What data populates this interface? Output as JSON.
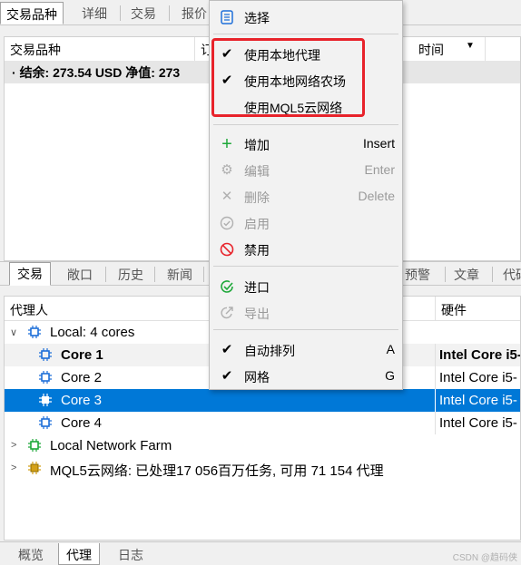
{
  "top_tabs": [
    "交易品种",
    "详细",
    "交易",
    "报价"
  ],
  "upper_headers": [
    "交易品种",
    "订",
    "时间"
  ],
  "balance_text": "结余: 273.54 USD  净值: 273",
  "mid_tabs": [
    "交易",
    "敞口",
    "历史",
    "新闻",
    "预警",
    "文章",
    "代码"
  ],
  "lower_headers": {
    "agent": "代理人",
    "hardware": "硬件"
  },
  "tree": {
    "local": "Local: 4 cores",
    "cores": [
      {
        "name": "Core 1",
        "hardware": "Intel Core i5-"
      },
      {
        "name": "Core 2",
        "hardware": "Intel Core i5-"
      },
      {
        "name": "Core 3",
        "hardware": "Intel Core i5-"
      },
      {
        "name": "Core 4",
        "hardware": "Intel Core i5-"
      }
    ],
    "farm": "Local Network Farm",
    "cloud": "MQL5云网络: 已处理17 056百万任务, 可用 71 154 代理"
  },
  "bottom_tabs": [
    "概览",
    "代理",
    "日志"
  ],
  "watermark": "CSDN @趋码侠",
  "menu": {
    "select": "选择",
    "use_local_agents": "使用本地代理",
    "use_local_farm": "使用本地网络农场",
    "use_cloud": "使用MQL5云网络",
    "add": "增加",
    "add_sc": "Insert",
    "edit": "编辑",
    "edit_sc": "Enter",
    "delete": "删除",
    "delete_sc": "Delete",
    "enable": "启用",
    "disable": "禁用",
    "import": "进口",
    "export": "导出",
    "auto_arrange": "自动排列",
    "auto_arrange_sc": "A",
    "grid": "网格",
    "grid_sc": "G"
  },
  "colors": {
    "selection": "#0078d7",
    "highlight_box": "#e8232b",
    "chip_blue": "#1e6fd9",
    "chip_green": "#1ea83a",
    "chip_gold": "#d4a017"
  }
}
